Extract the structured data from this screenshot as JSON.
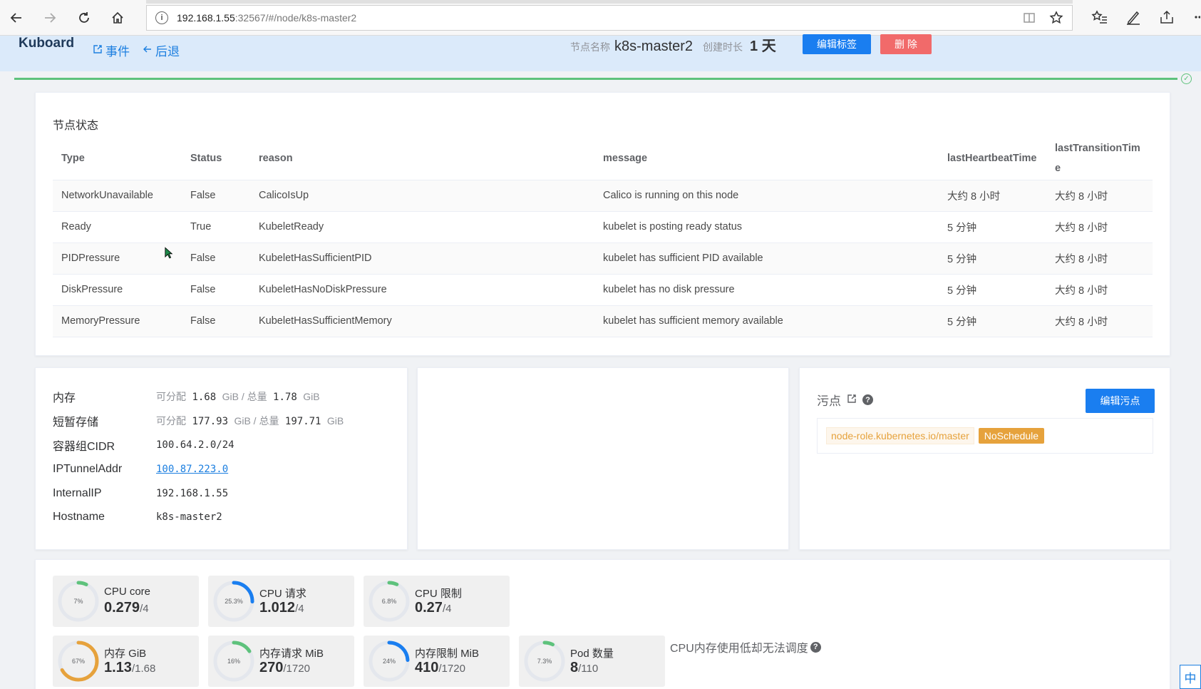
{
  "browser": {
    "url_host": "192.168.1.55",
    "url_path": ":32567/#/node/k8s-master2"
  },
  "header": {
    "brand": "Kuboard",
    "events_link": "事件",
    "back_link": "后退",
    "node_name_label": "节点名称",
    "node_name": "k8s-master2",
    "created_label": "创建时长",
    "created_value": "1 天",
    "edit_labels_button": "编辑标签",
    "delete_button": "删 除"
  },
  "status_section": {
    "title": "节点状态",
    "columns": [
      "Type",
      "Status",
      "reason",
      "message",
      "lastHeartbeatTime",
      "lastTransitionTime"
    ],
    "rows": [
      [
        "NetworkUnavailable",
        "False",
        "CalicoIsUp",
        "Calico is running on this node",
        "大约 8 小时",
        "大约 8 小时"
      ],
      [
        "Ready",
        "True",
        "KubeletReady",
        "kubelet is posting ready status",
        "5 分钟",
        "大约 8 小时"
      ],
      [
        "PIDPressure",
        "False",
        "KubeletHasSufficientPID",
        "kubelet has sufficient PID available",
        "5 分钟",
        "大约 8 小时"
      ],
      [
        "DiskPressure",
        "False",
        "KubeletHasNoDiskPressure",
        "kubelet has no disk pressure",
        "5 分钟",
        "大约 8 小时"
      ],
      [
        "MemoryPressure",
        "False",
        "KubeletHasSufficientMemory",
        "kubelet has sufficient memory available",
        "5 分钟",
        "大约 8 小时"
      ]
    ]
  },
  "info": {
    "memory_label": "内存",
    "memory_alloc_prefix": "可分配",
    "memory_alloc": "1.68",
    "memory_total_prefix": "GiB / 总量",
    "memory_total": "1.78",
    "memory_unit": "GiB",
    "ephemeral_label": "短暂存储",
    "ephemeral_alloc_prefix": "可分配",
    "ephemeral_alloc": "177.93",
    "ephemeral_total_prefix": "GiB / 总量",
    "ephemeral_total": "197.71",
    "ephemeral_unit": "GiB",
    "cidr_label": "容器组CIDR",
    "cidr_value": "100.64.2.0/24",
    "tunnel_label": "IPTunnelAddr",
    "tunnel_value": "100.87.223.0",
    "internal_ip_label": "InternalIP",
    "internal_ip_value": "192.168.1.55",
    "hostname_label": "Hostname",
    "hostname_value": "k8s-master2"
  },
  "taints": {
    "title": "污点",
    "edit_button": "编辑污点",
    "items": [
      {
        "key": "node-role.kubernetes.io/master",
        "effect": "NoSchedule"
      }
    ]
  },
  "metrics": [
    {
      "label": "CPU core",
      "value": "0.279",
      "total": "/4",
      "percent_text": "7%",
      "fraction": 0.07,
      "color": "#5ec27c"
    },
    {
      "label": "CPU 请求",
      "value": "1.012",
      "total": "/4",
      "percent_text": "25.3%",
      "fraction": 0.253,
      "color": "#1a7ef0"
    },
    {
      "label": "CPU 限制",
      "value": "0.27",
      "total": "/4",
      "percent_text": "6.8%",
      "fraction": 0.068,
      "color": "#5ec27c"
    },
    {
      "label": "内存 GiB",
      "value": "1.13",
      "total": "/1.68",
      "percent_text": "67%",
      "fraction": 0.67,
      "color": "#e6a23c"
    },
    {
      "label": "内存请求 MiB",
      "value": "270",
      "total": "/1720",
      "percent_text": "16%",
      "fraction": 0.16,
      "color": "#5ec27c"
    },
    {
      "label": "内存限制 MiB",
      "value": "410",
      "total": "/1720",
      "percent_text": "24%",
      "fraction": 0.24,
      "color": "#1a7ef0"
    },
    {
      "label": "Pod 数量",
      "value": "8",
      "total": "/110",
      "percent_text": "7.3%",
      "fraction": 0.073,
      "color": "#5ec27c"
    }
  ],
  "schedule_note": "CPU内存使用低却无法调度",
  "ime_indicator": "中",
  "colors": {
    "header_bg": "#dbeafa",
    "primary": "#1a7ef0",
    "danger": "#f16a6a",
    "success": "#5ec27c",
    "warning": "#e6a23c"
  }
}
